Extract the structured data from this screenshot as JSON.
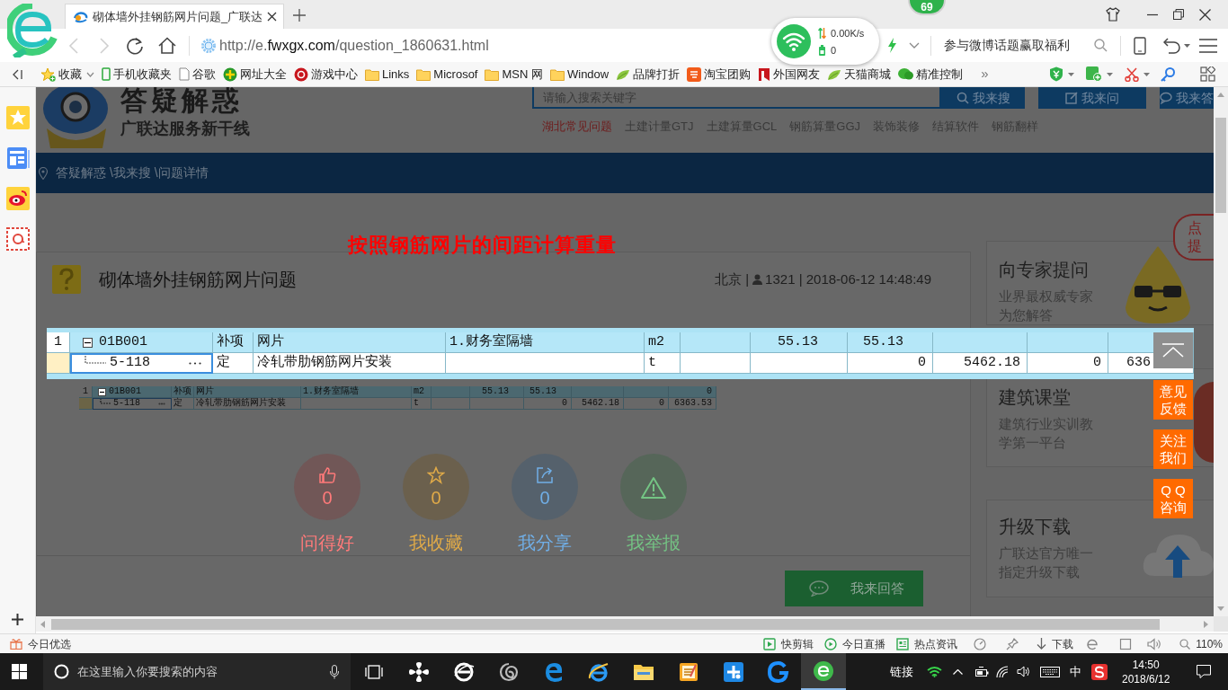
{
  "browser": {
    "tab": {
      "title": "砌体墙外挂钢筋网片问题_广联达"
    },
    "badge": "69",
    "address": {
      "scheme": "http://e.",
      "domain": "fwxgx.com",
      "path": "/question_1860631.html"
    },
    "network_widget": {
      "speed": "0.00K/s",
      "count": "0"
    },
    "promo": "参与微博话题赢取福利",
    "bookmarks": [
      {
        "label": "收藏"
      },
      {
        "label": "手机收藏夹"
      },
      {
        "label": "谷歌"
      },
      {
        "label": "网址大全"
      },
      {
        "label": "游戏中心"
      },
      {
        "label": "Links"
      },
      {
        "label": "Microsof"
      },
      {
        "label": "MSN 网"
      },
      {
        "label": "Window"
      },
      {
        "label": "品牌打折"
      },
      {
        "label": "淘宝团购"
      },
      {
        "label": "外国网友"
      },
      {
        "label": "天猫商城"
      },
      {
        "label": "精准控制"
      }
    ],
    "bookmarks_more": "»"
  },
  "page": {
    "logo_title": "答疑解惑",
    "logo_slogan": "广联达服务新干线",
    "search": {
      "placeholder": "请输入搜索关键字"
    },
    "header_buttons": [
      "我来搜",
      "我来问",
      "我来答"
    ],
    "nav": [
      {
        "label": "湖北常见问题",
        "selected": true
      },
      {
        "label": "土建计量GTJ",
        "selected": false
      },
      {
        "label": "土建算量GCL",
        "selected": false
      },
      {
        "label": "钢筋算量GGJ",
        "selected": false
      },
      {
        "label": "装饰装修",
        "selected": false
      },
      {
        "label": "结算软件",
        "selected": false
      },
      {
        "label": "钢筋翻样",
        "selected": false
      }
    ],
    "breadcrumb": "答疑解惑 \\我来搜 \\问题详情",
    "question": {
      "title": "砌体墙外挂钢筋网片问题",
      "location": "北京 |",
      "views_and_time": "1321 | 2018-06-12 14:48:49"
    },
    "screenshot_table": {
      "rows": [
        {
          "kind": "group",
          "expanded": true,
          "selected": false,
          "column_1": "1",
          "column_2": "01B001",
          "column_3": "补项",
          "column_4": "网片",
          "column_5": "1.财务室隔墙",
          "column_6": "m2",
          "column_8": "55.13",
          "column_9": "55.13",
          "column_12": "0"
        },
        {
          "kind": "item",
          "selected": true,
          "column_2": "5-118",
          "column_3": "定",
          "column_4": "冷轧带肋钢筋网片安装",
          "column_6": "t",
          "column_9": "0",
          "column_10": "5462.18",
          "column_11": "0",
          "column_12": "6363.53"
        }
      ]
    },
    "actions": [
      {
        "kind": "like",
        "count": "0",
        "label": "问得好",
        "color": "#ff7a7a"
      },
      {
        "kind": "favorite",
        "count": "0",
        "label": "我收藏",
        "color": "#e0aa48"
      },
      {
        "kind": "share",
        "count": "0",
        "label": "我分享",
        "color": "#70aee6"
      },
      {
        "kind": "report",
        "label": "我举报",
        "color": "#74c484"
      }
    ],
    "answer_button": "我来回答",
    "side_cards": [
      {
        "title": "向专家提问",
        "text": "业界最权威专家为您解答"
      },
      {
        "title": "建筑课堂",
        "text": "建筑行业实训教学第一平台"
      },
      {
        "title": "升级下载",
        "text": "广联达官方唯一指定升级下载"
      }
    ],
    "ask_bubble": [
      "点",
      "提"
    ]
  },
  "lightbox": {
    "caption": "按照钢筋网片的间距计算重量",
    "rows": [
      {
        "kind": "group",
        "expanded": true,
        "selected": false,
        "column_1": "1",
        "column_2": "01B001",
        "column_3": "补项",
        "column_4": "网片",
        "column_5": "1.财务室隔墙",
        "column_6": "m2",
        "column_8": "55.13",
        "column_9": "55.13"
      },
      {
        "kind": "item",
        "selected": true,
        "column_2": "5-118",
        "column_3": "定",
        "column_4": "冷轧带肋钢筋网片安装",
        "column_6": "t",
        "column_9": "0",
        "column_10": "5462.18",
        "column_11": "0",
        "column_12": "636"
      }
    ]
  },
  "float_buttons": [
    "意见反馈",
    "关注我们",
    "Q Q咨询"
  ],
  "status_bar": {
    "left": "今日优选",
    "links": [
      "快剪辑",
      "今日直播",
      "热点资讯"
    ],
    "download": "下载",
    "zoom": "110%"
  },
  "taskbar": {
    "search_placeholder": "在这里输入你要搜索的内容",
    "apps": [
      {
        "selected": false
      },
      {
        "selected": false
      },
      {
        "selected": false
      },
      {
        "selected": false
      },
      {
        "selected": false
      },
      {
        "selected": false
      },
      {
        "selected": false
      },
      {
        "selected": false
      },
      {
        "selected": false
      },
      {
        "selected": true
      }
    ],
    "links": "链接",
    "ime": "中",
    "time": "14:50",
    "date": "2018/6/12"
  }
}
